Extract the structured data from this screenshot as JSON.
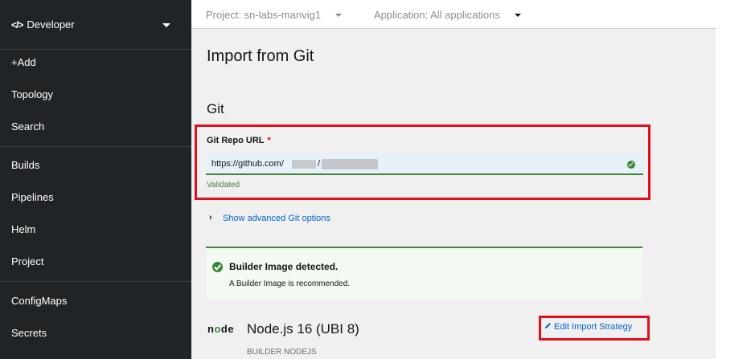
{
  "sidebar": {
    "perspective": {
      "icon": "code-icon",
      "label": "Developer"
    },
    "items": [
      {
        "label": "+Add"
      },
      {
        "label": "Topology"
      },
      {
        "label": "Search"
      },
      {
        "label": "Builds"
      },
      {
        "label": "Pipelines"
      },
      {
        "label": "Helm"
      },
      {
        "label": "Project"
      },
      {
        "label": "ConfigMaps"
      },
      {
        "label": "Secrets"
      }
    ]
  },
  "topbar": {
    "project": "Project: sn-labs-manvig1",
    "application": "Application: All applications"
  },
  "page": {
    "title": "Import from Git",
    "section": "Git"
  },
  "git_repo": {
    "label": "Git Repo URL",
    "required_marker": "*",
    "value": "https://github.com/",
    "separator": "/",
    "status": "Validated",
    "status_color": "#3e8635"
  },
  "advanced": {
    "label": "Show advanced Git options"
  },
  "alert": {
    "title": "Builder Image detected.",
    "body": "A Builder Image is recommended."
  },
  "builder": {
    "logo_text_n": "n",
    "logo_text_o": "o",
    "logo_text_de": "de",
    "title": "Node.js 16 (UBI 8)",
    "subtitle": "BUILDER NODEJS",
    "edit_label": "Edit Import Strategy"
  },
  "colors": {
    "highlight": "#e0101b",
    "link": "#0066cc",
    "success": "#3e8635"
  }
}
